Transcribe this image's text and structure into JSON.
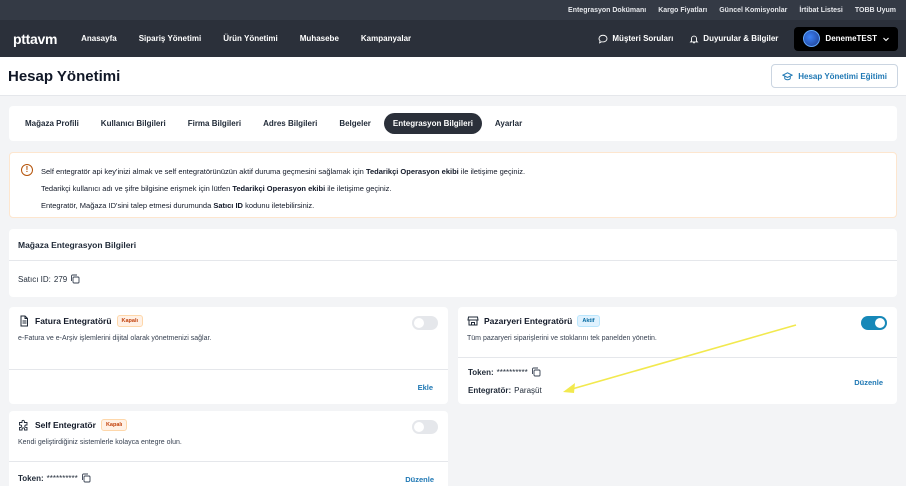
{
  "topbar": {
    "links": [
      "Entegrasyon Dokümanı",
      "Kargo Fiyatları",
      "Güncel Komisyonlar",
      "İrtibat Listesi",
      "TOBB Uyum"
    ]
  },
  "navbar": {
    "logo": "pttavm",
    "items": [
      "Anasayfa",
      "Sipariş Yönetimi",
      "Ürün Yönetimi",
      "Muhasebe",
      "Kampanyalar"
    ],
    "questions": "Müşteri Soruları",
    "announcements": "Duyurular & Bilgiler",
    "user": "DenemeTEST"
  },
  "header": {
    "title": "Hesap Yönetimi",
    "edu_button": "Hesap Yönetimi Eğitimi"
  },
  "tabs": {
    "items": [
      "Mağaza Profili",
      "Kullanıcı Bilgileri",
      "Firma Bilgileri",
      "Adres Bilgileri",
      "Belgeler",
      "Entegrasyon Bilgileri",
      "Ayarlar"
    ],
    "active": "Entegrasyon Bilgileri"
  },
  "info": {
    "line1_a": "Self entegratör api key'inizi almak ve self entegratörünüzün aktif duruma geçmesini sağlamak için",
    "line1_b": "Tedarikçi Operasyon ekibi",
    "line1_c": "ile iletişime geçiniz.",
    "line2_a": "Tedarikçi kullanıcı adı ve şifre bilgisine erişmek için lütfen",
    "line2_b": "Tedarikçi Operasyon ekibi",
    "line2_c": "ile iletişime geçiniz.",
    "line3_a": "Entegratör, Mağaza ID'sini talep etmesi durumunda",
    "line3_b": "Satıcı ID",
    "line3_c": "kodunu iletebilirsiniz."
  },
  "store": {
    "title": "Mağaza Entegrasyon Bilgileri",
    "seller_id_label": "Satıcı ID:",
    "seller_id_value": "279"
  },
  "fatura": {
    "title": "Fatura Entegratörü",
    "badge": "Kapalı",
    "desc": "e-Fatura ve e-Arşiv işlemlerini dijital olarak yönetmenizi sağlar.",
    "action": "Ekle",
    "enabled": false
  },
  "pazaryeri": {
    "title": "Pazaryeri Entegratörü",
    "badge": "Aktif",
    "desc": "Tüm pazaryeri siparişlerini ve stoklarını tek panelden yönetin.",
    "token_label": "Token:",
    "token_value": "**********",
    "integrator_label": "Entegratör:",
    "integrator_value": "Paraşüt",
    "action": "Düzenle",
    "enabled": true
  },
  "self": {
    "title": "Self Entegratör",
    "badge": "Kapalı",
    "desc": "Kendi geliştirdiğiniz sistemlerle kolayca entegre olun.",
    "token_label": "Token:",
    "token_value": "**********",
    "action": "Düzenle",
    "enabled": false
  },
  "colors": {
    "annotation_arrow": "#f2e94e",
    "accent": "#1f78b4",
    "toggle_on": "#1788b8"
  }
}
